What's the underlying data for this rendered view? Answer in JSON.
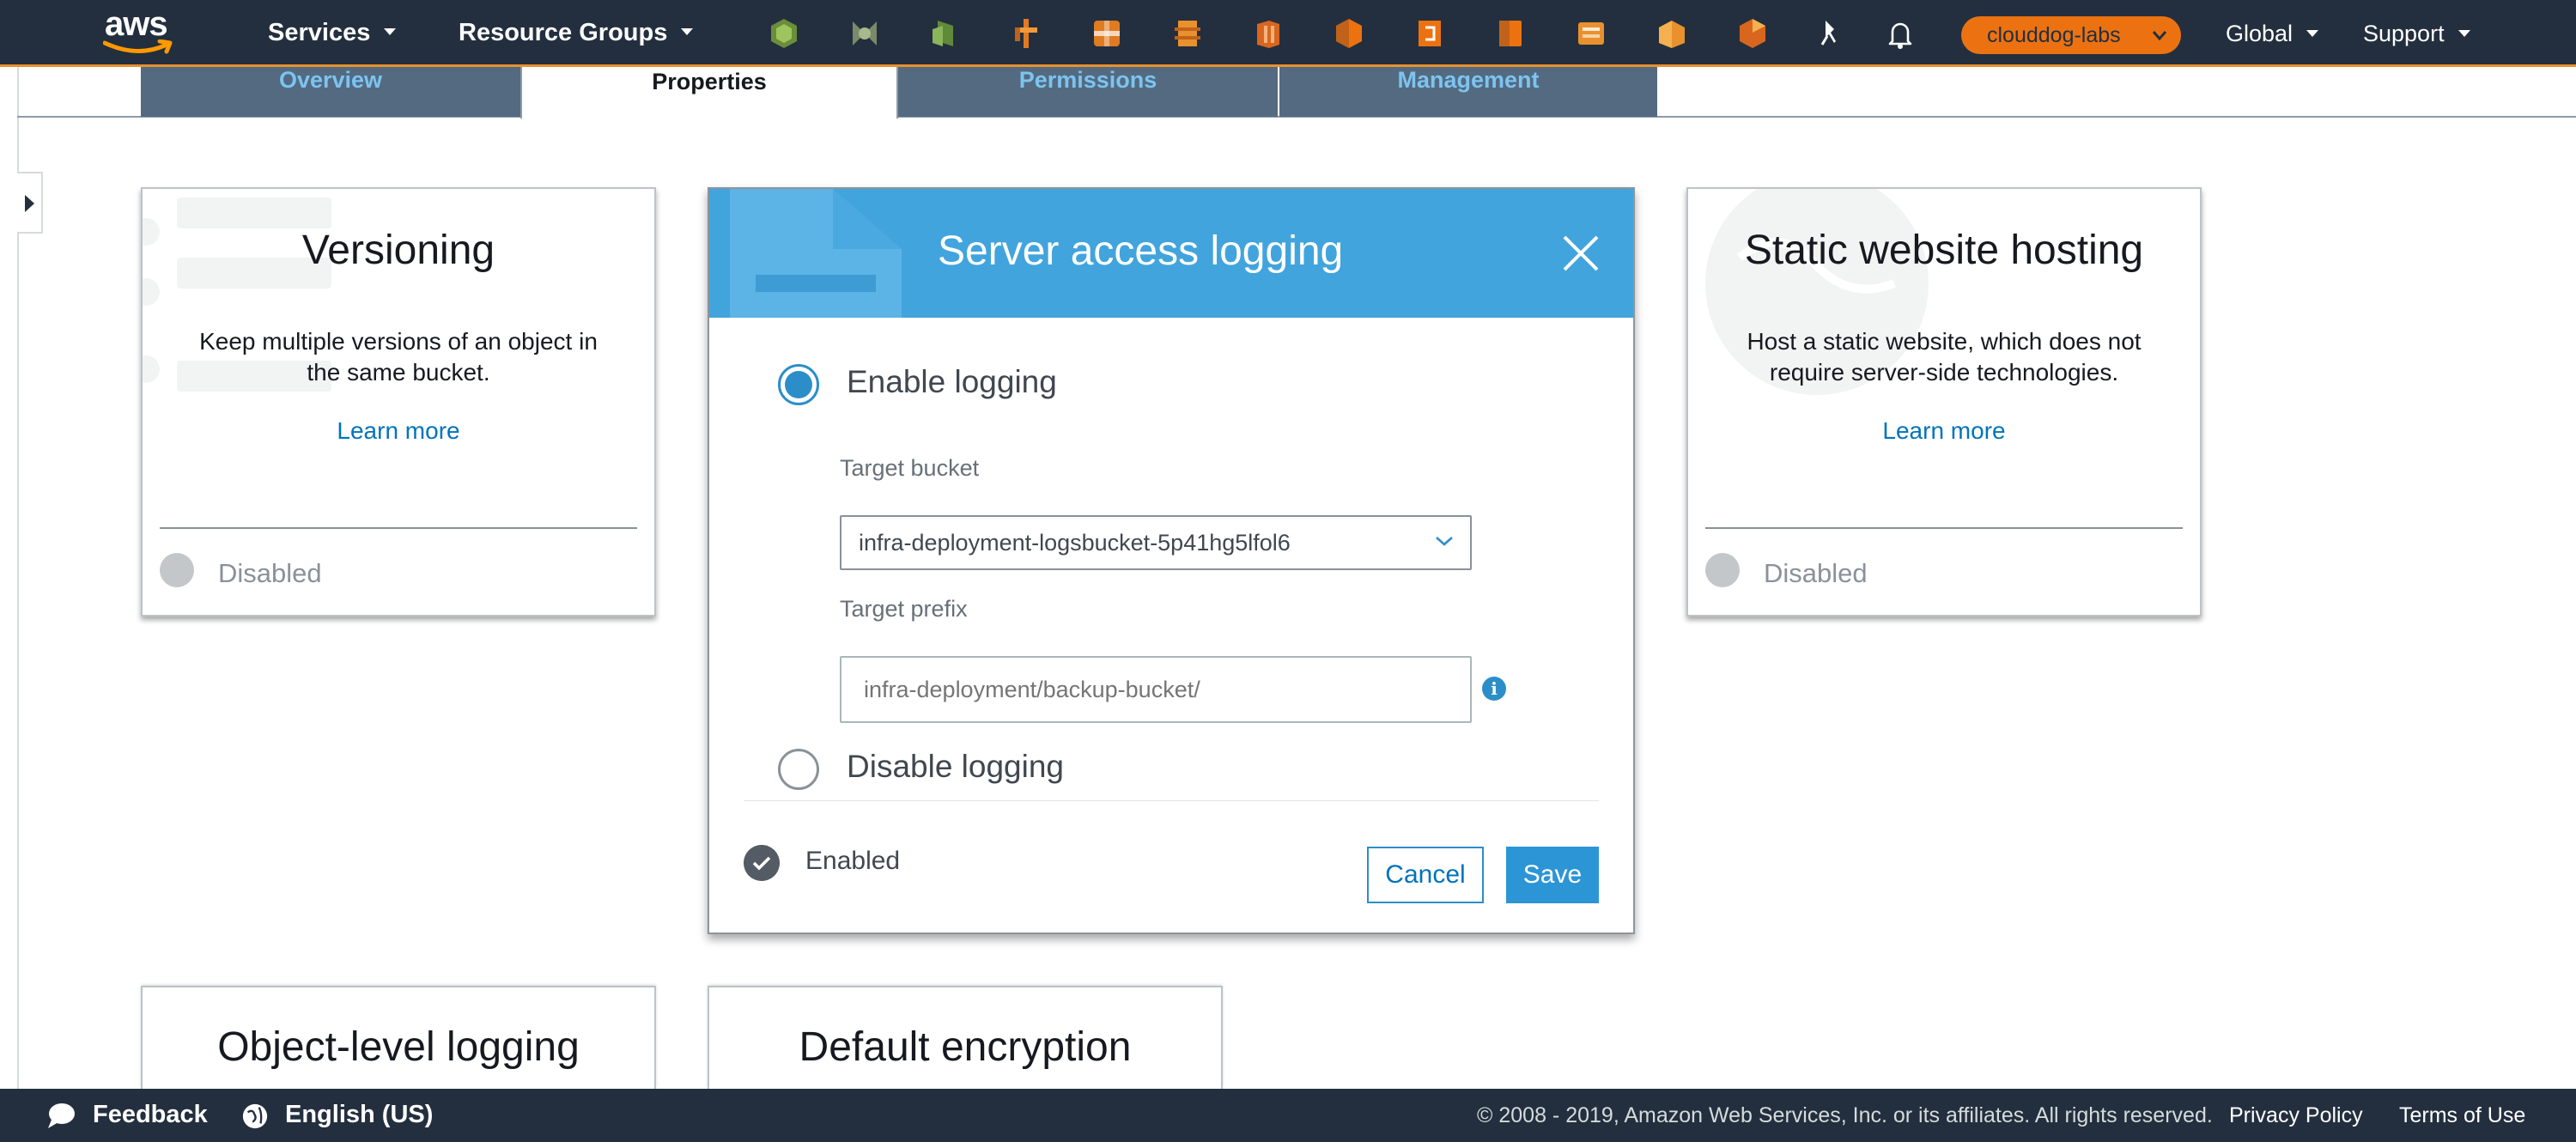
{
  "nav": {
    "logo_text": "aws",
    "services_label": "Services",
    "resource_groups_label": "Resource Groups",
    "service_shortcuts": [
      "service-shortcut-1",
      "service-shortcut-2",
      "service-shortcut-3",
      "service-shortcut-4",
      "service-shortcut-5",
      "service-shortcut-6",
      "service-shortcut-7",
      "service-shortcut-8",
      "service-shortcut-9",
      "service-shortcut-10",
      "service-shortcut-11",
      "service-shortcut-12",
      "service-shortcut-13"
    ],
    "account_label": "clouddog-labs",
    "region_label": "Global",
    "support_label": "Support",
    "accent_color": "#ec7211",
    "bar_color": "#232f3e"
  },
  "tabs": [
    {
      "label": "Overview",
      "active": false
    },
    {
      "label": "Properties",
      "active": true
    },
    {
      "label": "Permissions",
      "active": false
    },
    {
      "label": "Management",
      "active": false
    }
  ],
  "cards": {
    "versioning": {
      "title": "Versioning",
      "description": "Keep multiple versions of an object in the same bucket.",
      "learn_more": "Learn more",
      "status": "Disabled"
    },
    "static_website": {
      "title": "Static website hosting",
      "description": "Host a static website, which does not require server-side technologies.",
      "learn_more": "Learn more",
      "status": "Disabled"
    },
    "object_logging": {
      "title": "Object-level logging"
    },
    "default_encryption": {
      "title": "Default encryption"
    }
  },
  "modal": {
    "title": "Server access logging",
    "enable_label": "Enable logging",
    "disable_label": "Disable logging",
    "selected_option": "Enable logging",
    "target_bucket_label": "Target bucket",
    "target_bucket_value": "infra-deployment-logsbucket-5p41hg5lfol6",
    "target_prefix_label": "Target prefix",
    "target_prefix_placeholder": "infra-deployment/backup-bucket/",
    "status": "Enabled",
    "cancel_label": "Cancel",
    "save_label": "Save",
    "header_color": "#42a4dd"
  },
  "footer": {
    "feedback": "Feedback",
    "language": "English (US)",
    "copyright": "© 2008 - 2019, Amazon Web Services, Inc. or its affiliates. All rights reserved.",
    "privacy": "Privacy Policy",
    "terms": "Terms of Use"
  }
}
